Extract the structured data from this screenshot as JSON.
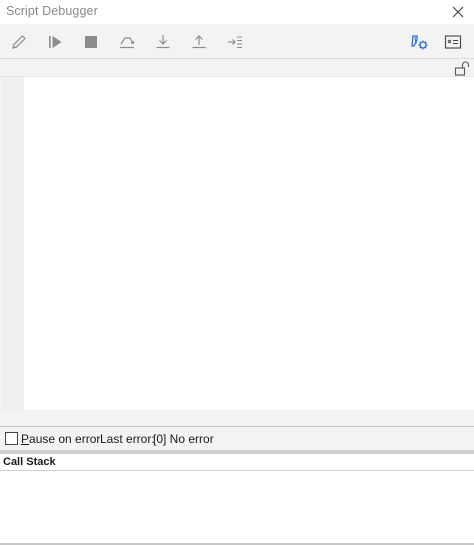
{
  "window": {
    "title": "Script Debugger",
    "close_icon": "close-icon"
  },
  "toolbar": {
    "left_buttons": [
      "edit-icon",
      "run-icon",
      "stop-icon",
      "step-over-icon",
      "step-into-icon",
      "step-out-icon",
      "step-next-icon"
    ],
    "right_buttons": [
      "debug-settings-icon",
      "immediate-window-icon"
    ],
    "accent_color": "#2b6fd6"
  },
  "editor": {
    "lock_icon": "unlock-icon"
  },
  "status": {
    "pause_label_accel": "P",
    "pause_label_rest": "ause on error",
    "pause_checked": false,
    "last_error_label": "Last error:",
    "last_error_value": "[0] No error"
  },
  "callstack": {
    "title": "Call Stack"
  }
}
